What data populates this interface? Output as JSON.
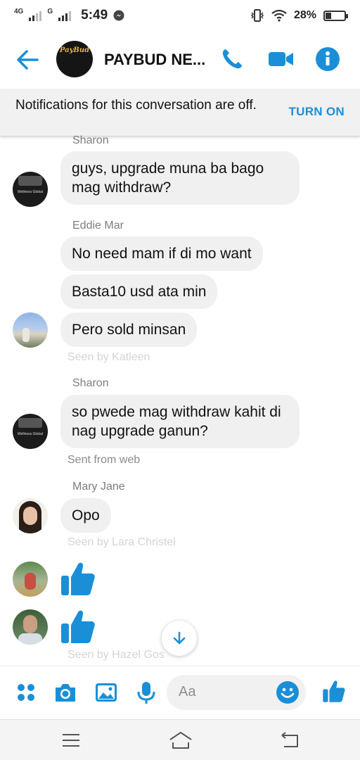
{
  "status_bar": {
    "network_1": "4G",
    "network_2": "G",
    "time": "5:49",
    "battery": "28%",
    "battery_level": 0.28
  },
  "header": {
    "logo_text": "PayBud",
    "title": "PAYBUD NE...",
    "icons": [
      "back-arrow-icon",
      "phone-icon",
      "video-camera-icon",
      "info-icon"
    ],
    "accent_color": "#1a8fd8"
  },
  "notice": {
    "text": "Notifications for this conversation are off.",
    "action": "TURN ON"
  },
  "messages": [
    {
      "sender": "Sharon",
      "text": "guys, upgrade muna ba bago mag withdraw?"
    },
    {
      "sender": "Eddie Mar",
      "bubbles": [
        "No need mam if di mo want",
        "Basta10 usd ata min",
        "Pero sold minsan"
      ],
      "seen": "Seen by Katleen"
    },
    {
      "sender": "Sharon",
      "text": "so pwede mag withdraw kahit di nag upgrade ganun?",
      "meta": "Sent from web"
    },
    {
      "sender": "Mary Jane",
      "text": "Opo",
      "seen": "Seen by Lara Christel"
    },
    {
      "type": "like",
      "icon": "thumbs-up-icon"
    },
    {
      "type": "like",
      "icon": "thumbs-up-icon",
      "seen": "Seen by Hazel Gos"
    }
  ],
  "avatar_group_text": "Wellness Global",
  "composer": {
    "placeholder": "Aa",
    "icons": [
      "apps-grid-icon",
      "camera-icon",
      "gallery-icon",
      "microphone-icon",
      "emoji-icon",
      "thumbs-up-icon"
    ]
  },
  "navbar": {
    "icons": [
      "menu-icon",
      "home-icon",
      "back-icon"
    ]
  }
}
